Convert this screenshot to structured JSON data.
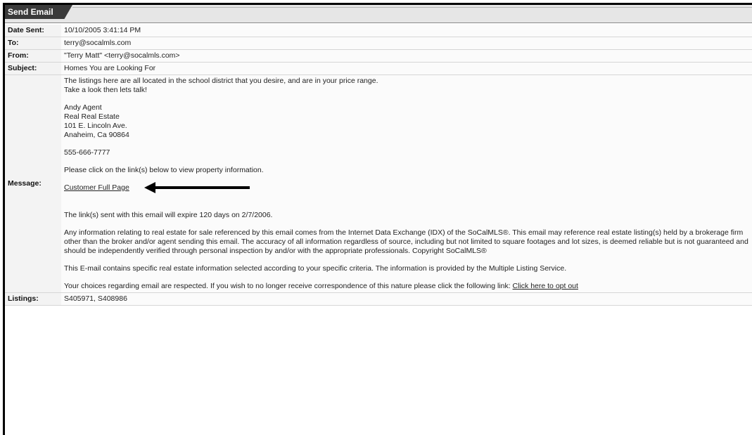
{
  "window": {
    "title": "Send Email"
  },
  "labels": {
    "date_sent": "Date Sent:",
    "to": "To:",
    "from": "From:",
    "subject": "Subject:",
    "message": "Message:",
    "listings": "Listings:"
  },
  "email": {
    "date_sent": "10/10/2005 3:41:14 PM",
    "to": "terry@socalmls.com",
    "from": "\"Terry Matt\" <terry@socalmls.com>",
    "subject": "Homes You are Looking For",
    "listings": "S405971, S408986"
  },
  "message": {
    "intro_line1": "The listings here are all located in the school district that you desire, and are in your price range.",
    "intro_line2": "Take a look then lets talk!",
    "signature": {
      "name": "Andy Agent",
      "company": "Real Real Estate",
      "street": "101 E. Lincoln Ave.",
      "city": "Anaheim, Ca  90864"
    },
    "phone": "555-666-7777",
    "click_instruction": "Please click on the link(s) below to view property information.",
    "link_label": "Customer Full Page",
    "expiry": "The link(s) sent with this email will expire 120 days on 2/7/2006.",
    "idx_disclaimer": "Any information relating to real estate for sale referenced by this email comes from the Internet Data Exchange (IDX) of the SoCalMLS®. This email may reference real estate listing(s) held by a brokerage firm other than the broker and/or agent sending this email. The accuracy of all information regardless of source, including but not limited to square footages and lot sizes, is deemed reliable but is not guaranteed and should be independently verified through personal inspection by and/or with the appropriate professionals. Copyright SoCalMLS®",
    "criteria_note": "This E-mail contains specific real estate information selected according to your specific criteria. The information is provided by the Multiple Listing Service.",
    "opt_out_text": "Your choices regarding email are respected. If you wish to no longer receive correspondence of this nature please click the following link: ",
    "opt_out_link": "Click here to opt out"
  }
}
